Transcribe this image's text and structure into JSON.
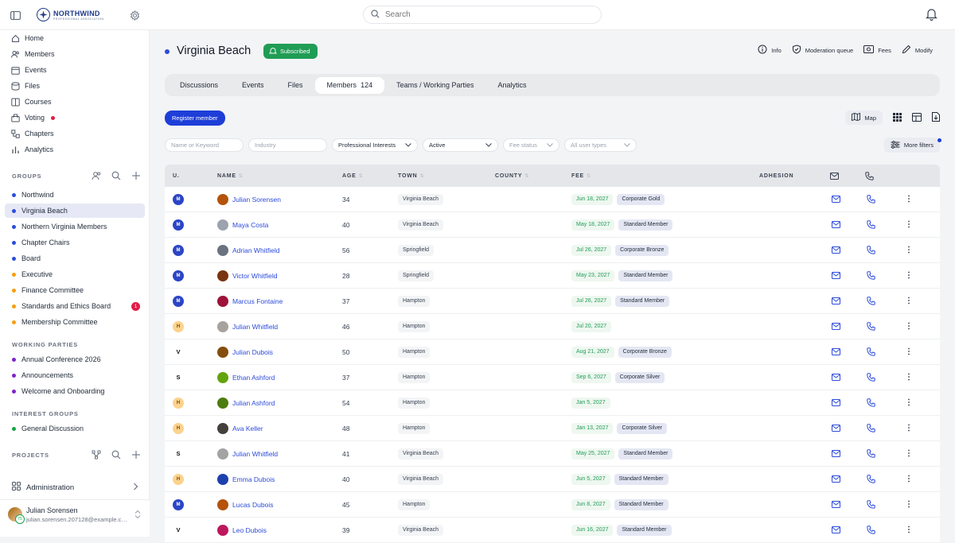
{
  "brand": {
    "name": "NORTHWIND",
    "tagline": "PROFESSIONAL ASSOCIATION"
  },
  "search": {
    "placeholder": "Search"
  },
  "sidebar": {
    "nav": [
      {
        "label": "Home",
        "icon": "home-icon"
      },
      {
        "label": "Members",
        "icon": "members-icon"
      },
      {
        "label": "Events",
        "icon": "calendar-icon"
      },
      {
        "label": "Files",
        "icon": "files-icon"
      },
      {
        "label": "Courses",
        "icon": "book-icon"
      },
      {
        "label": "Voting",
        "icon": "ballot-icon"
      },
      {
        "label": "Chapters",
        "icon": "chapters-icon"
      },
      {
        "label": "Analytics",
        "icon": "analytics-icon"
      }
    ],
    "groups_label": "GROUPS",
    "groups": [
      {
        "label": "Northwind",
        "color": "#2d4bdb"
      },
      {
        "label": "Virginia Beach",
        "color": "#2d4bdb"
      },
      {
        "label": "Northern Virginia Members",
        "color": "#2d4bdb"
      },
      {
        "label": "Chapter Chairs",
        "color": "#2d4bdb"
      },
      {
        "label": "Board",
        "color": "#2d4bdb"
      },
      {
        "label": "Executive",
        "color": "#f59e0b"
      },
      {
        "label": "Finance Committee",
        "color": "#f59e0b"
      },
      {
        "label": "Standards and Ethics Board",
        "color": "#f59e0b",
        "badge": "1"
      },
      {
        "label": "Membership Committee",
        "color": "#f59e0b"
      }
    ],
    "working_label": "WORKING PARTIES",
    "working": [
      {
        "label": "Annual Conference 2026",
        "color": "#7e22ce"
      },
      {
        "label": "Announcements",
        "color": "#7e22ce"
      },
      {
        "label": "Welcome and Onboarding",
        "color": "#7e22ce"
      }
    ],
    "interest_label": "INTEREST GROUPS",
    "interest": [
      {
        "label": "General Discussion",
        "color": "#16a34a"
      }
    ],
    "projects_label": "PROJECTS",
    "admin_label": "Administration",
    "user": {
      "name": "Julian Sorensen",
      "email": "julian.sorensen.207128@example.com",
      "badge": "75"
    }
  },
  "page": {
    "title": "Virginia Beach",
    "status": "Subscribed",
    "actions": [
      "Info",
      "Moderation queue",
      "Fees",
      "Modify"
    ],
    "tabs": [
      {
        "label": "Discussions"
      },
      {
        "label": "Events"
      },
      {
        "label": "Files"
      },
      {
        "label": "Members",
        "count": "124"
      },
      {
        "label": "Teams / Working Parties"
      },
      {
        "label": "Analytics"
      }
    ],
    "register_label": "Register member",
    "map_label": "Map",
    "more_filters_label": "More filters"
  },
  "filters": {
    "name_placeholder": "Name or Keyword",
    "industry_placeholder": "Industry",
    "interests": "Professional Interests",
    "status": "Active",
    "fee_status": "Fee status",
    "user_types": "All user types"
  },
  "table": {
    "headers": {
      "u": "U.",
      "name": "NAME",
      "age": "AGE",
      "town": "TOWN",
      "county": "COUNTY",
      "fee": "FEE",
      "adhesion": "ADHESION"
    },
    "rows": [
      {
        "u": "M",
        "name": "Julian Sorensen",
        "age": "34",
        "town": "Virginia Beach",
        "fee_date": "Jun 18, 2027",
        "tier": "Corporate Gold",
        "av": "#b45309"
      },
      {
        "u": "M",
        "name": "Maya Costa",
        "age": "40",
        "town": "Virginia Beach",
        "fee_date": "May 18, 2027",
        "tier": "Standard Member",
        "av": "#9ca3af"
      },
      {
        "u": "M",
        "name": "Adrian Whitfield",
        "age": "56",
        "town": "Springfield",
        "fee_date": "Jul 26, 2027",
        "tier": "Corporate Bronze",
        "av": "#6b7280"
      },
      {
        "u": "M",
        "name": "Victor Whitfield",
        "age": "28",
        "town": "Springfield",
        "fee_date": "May 23, 2027",
        "tier": "Standard Member",
        "av": "#78350f"
      },
      {
        "u": "M",
        "name": "Marcus Fontaine",
        "age": "37",
        "town": "Hampton",
        "fee_date": "Jul 26, 2027",
        "tier": "Standard Member",
        "av": "#9f1239"
      },
      {
        "u": "H",
        "name": "Julian Whitfield",
        "age": "46",
        "town": "Hampton",
        "fee_date": "Jul 20, 2027",
        "tier": "",
        "av": "#a8a29e"
      },
      {
        "u": "V",
        "name": "Julian Dubois",
        "age": "50",
        "town": "Hampton",
        "fee_date": "Aug 21, 2027",
        "tier": "Corporate Bronze",
        "av": "#854d0e"
      },
      {
        "u": "S",
        "name": "Ethan Ashford",
        "age": "37",
        "town": "Hampton",
        "fee_date": "Sep 6, 2027",
        "tier": "Corporate Silver",
        "av": "#65a30d"
      },
      {
        "u": "H",
        "name": "Julian Ashford",
        "age": "54",
        "town": "Hampton",
        "fee_date": "Jan 5, 2027",
        "tier": "",
        "av": "#4d7c0f"
      },
      {
        "u": "H",
        "name": "Ava Keller",
        "age": "48",
        "town": "Hampton",
        "fee_date": "Jan 13, 2027",
        "tier": "Corporate Silver",
        "av": "#44403c"
      },
      {
        "u": "S",
        "name": "Julian Whitfield",
        "age": "41",
        "town": "Virginia Beach",
        "fee_date": "May 25, 2027",
        "tier": "Standard Member",
        "av": "#a3a3a3"
      },
      {
        "u": "H",
        "name": "Emma Dubois",
        "age": "40",
        "town": "Virginia Beach",
        "fee_date": "Jun 5, 2027",
        "tier": "Standard Member",
        "av": "#1e40af"
      },
      {
        "u": "M",
        "name": "Lucas Dubois",
        "age": "45",
        "town": "Hampton",
        "fee_date": "Jun 8, 2027",
        "tier": "Standard Member",
        "av": "#b45309"
      },
      {
        "u": "V",
        "name": "Leo Dubois",
        "age": "39",
        "town": "Virginia Beach",
        "fee_date": "Jun 16, 2027",
        "tier": "Standard Member",
        "av": "#be185d"
      }
    ]
  }
}
